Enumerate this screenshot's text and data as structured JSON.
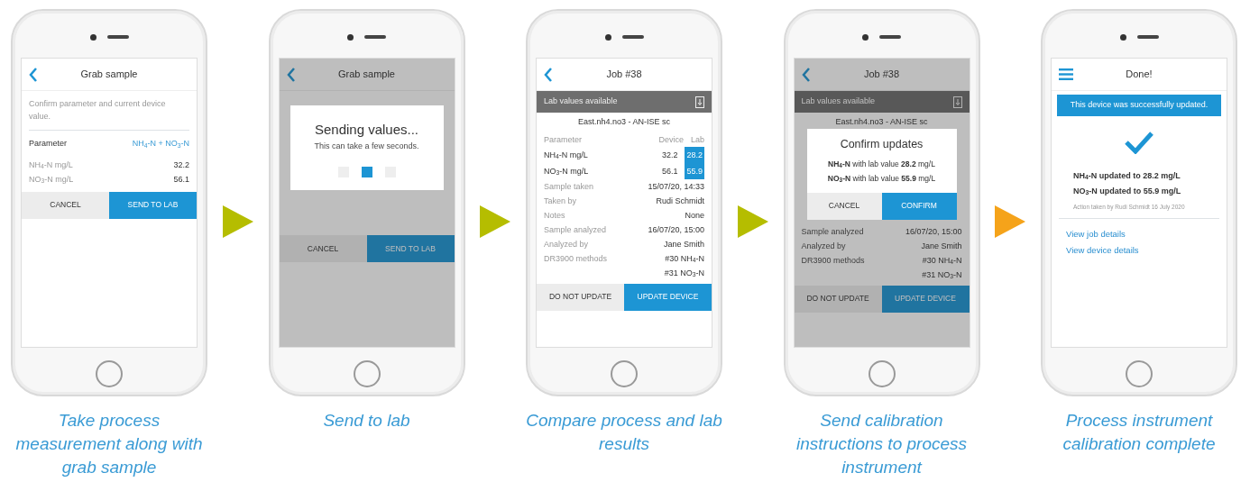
{
  "steps": [
    {
      "caption": "Take process measurement along with grab sample",
      "screen": {
        "kind": "form",
        "header": {
          "nav": {
            "kind": "back"
          },
          "title": "Grab sample"
        },
        "intro": "Confirm parameter and current device value.",
        "parameter_label": "Parameter",
        "parameter_value": "NH$_{4}$-N + NO$_{3}$-N",
        "rows": [
          {
            "label": "NH$_{4}$-N mg/L",
            "value": "32.2"
          },
          {
            "label": "NO$_{3}$-N mg/L",
            "value": "56.1"
          }
        ],
        "buttons": [
          {
            "label": "CANCEL",
            "primary": false
          },
          {
            "label": "SEND TO LAB",
            "primary": true
          }
        ]
      }
    },
    {
      "caption": "Send to lab",
      "screen": {
        "kind": "form",
        "header": {
          "nav": {
            "kind": "back"
          },
          "title": "Grab sample"
        },
        "buttons": [
          {
            "label": "CANCEL",
            "primary": false
          },
          {
            "label": "SEND TO LAB",
            "primary": true
          }
        ],
        "dialog": {
          "kind": "progress",
          "title": "Sending values...",
          "text": "This can take a few seconds.",
          "dots": [
            {
              "selected": false
            },
            {
              "selected": true
            },
            {
              "selected": false
            }
          ]
        }
      }
    },
    {
      "caption": "Compare process and lab results",
      "screen": {
        "kind": "job",
        "header": {
          "nav": {
            "kind": "back"
          },
          "title": "Job #38"
        },
        "banner": "Lab values available",
        "device": "East.nh4.no3 - AN-ISE sc",
        "columns": [
          "Parameter",
          "Device",
          "Lab"
        ],
        "values": [
          {
            "label": "NH$_{4}$-N mg/L",
            "device": "32.2",
            "lab": "28.2"
          },
          {
            "label": "NO$_{3}$-N mg/L",
            "device": "56.1",
            "lab": "55.9"
          }
        ],
        "details": [
          {
            "label": "Sample taken",
            "values": [
              "15/07/20, 14:33"
            ]
          },
          {
            "label": "Taken by",
            "values": [
              "Rudi Schmidt"
            ]
          },
          {
            "label": "Notes",
            "values": [
              "None"
            ]
          },
          {
            "label": "Sample analyzed",
            "values": [
              "16/07/20, 15:00"
            ]
          },
          {
            "label": "Analyzed by",
            "values": [
              "Jane Smith"
            ]
          },
          {
            "label": "DR3900 methods",
            "values": [
              "#30 NH$_{4}$-N",
              "#31 NO$_{3}$-N"
            ]
          }
        ],
        "buttons": [
          {
            "label": "DO NOT UPDATE",
            "primary": false
          },
          {
            "label": "UPDATE DEVICE",
            "primary": true
          }
        ]
      }
    },
    {
      "caption": "Send calibration instructions to process instrument",
      "screen": {
        "kind": "job",
        "header": {
          "nav": {
            "kind": "back"
          },
          "title": "Job #38"
        },
        "banner": "Lab values available",
        "device": "East.nh4.no3 - AN-ISE sc",
        "details": [
          {
            "label": "Sample analyzed",
            "values": [
              "16/07/20, 15:00"
            ]
          },
          {
            "label": "Analyzed by",
            "values": [
              "Jane Smith"
            ]
          },
          {
            "label": "DR3900 methods",
            "values": [
              "#30 NH$_{4}$-N",
              "#31 NO$_{3}$-N"
            ]
          }
        ],
        "buttons": [
          {
            "label": "DO NOT UPDATE",
            "primary": false
          },
          {
            "label": "UPDATE DEVICE",
            "primary": true
          }
        ],
        "dialog": {
          "kind": "confirm",
          "title": "Confirm updates",
          "lines": [
            "**NH$_{4}$-N** with lab value **28.2** mg/L",
            "**NO$_{3}$-N** with lab value **55.9** mg/L"
          ],
          "buttons": [
            {
              "label": "CANCEL",
              "primary": false
            },
            {
              "label": "CONFIRM",
              "primary": true
            }
          ]
        }
      }
    },
    {
      "caption": "Process instrument calibration complete",
      "screen": {
        "kind": "done",
        "header": {
          "nav": {
            "kind": "menu"
          },
          "title": "Done!"
        },
        "alert": "This device was successfully updated.",
        "updates": [
          "NH$_{4}$-N updated to 28.2 mg/L",
          "NO$_{3}$-N updated to 55.9 mg/L"
        ],
        "note": "Action taken by Rudi Schmidt 16 July 2020",
        "links": [
          "View job details",
          "View device details"
        ]
      }
    }
  ],
  "arrows": [
    {
      "color": "#b5bd00"
    },
    {
      "color": "#b5bd00"
    },
    {
      "color": "#b5bd00"
    },
    {
      "color": "#f5a31a"
    }
  ]
}
